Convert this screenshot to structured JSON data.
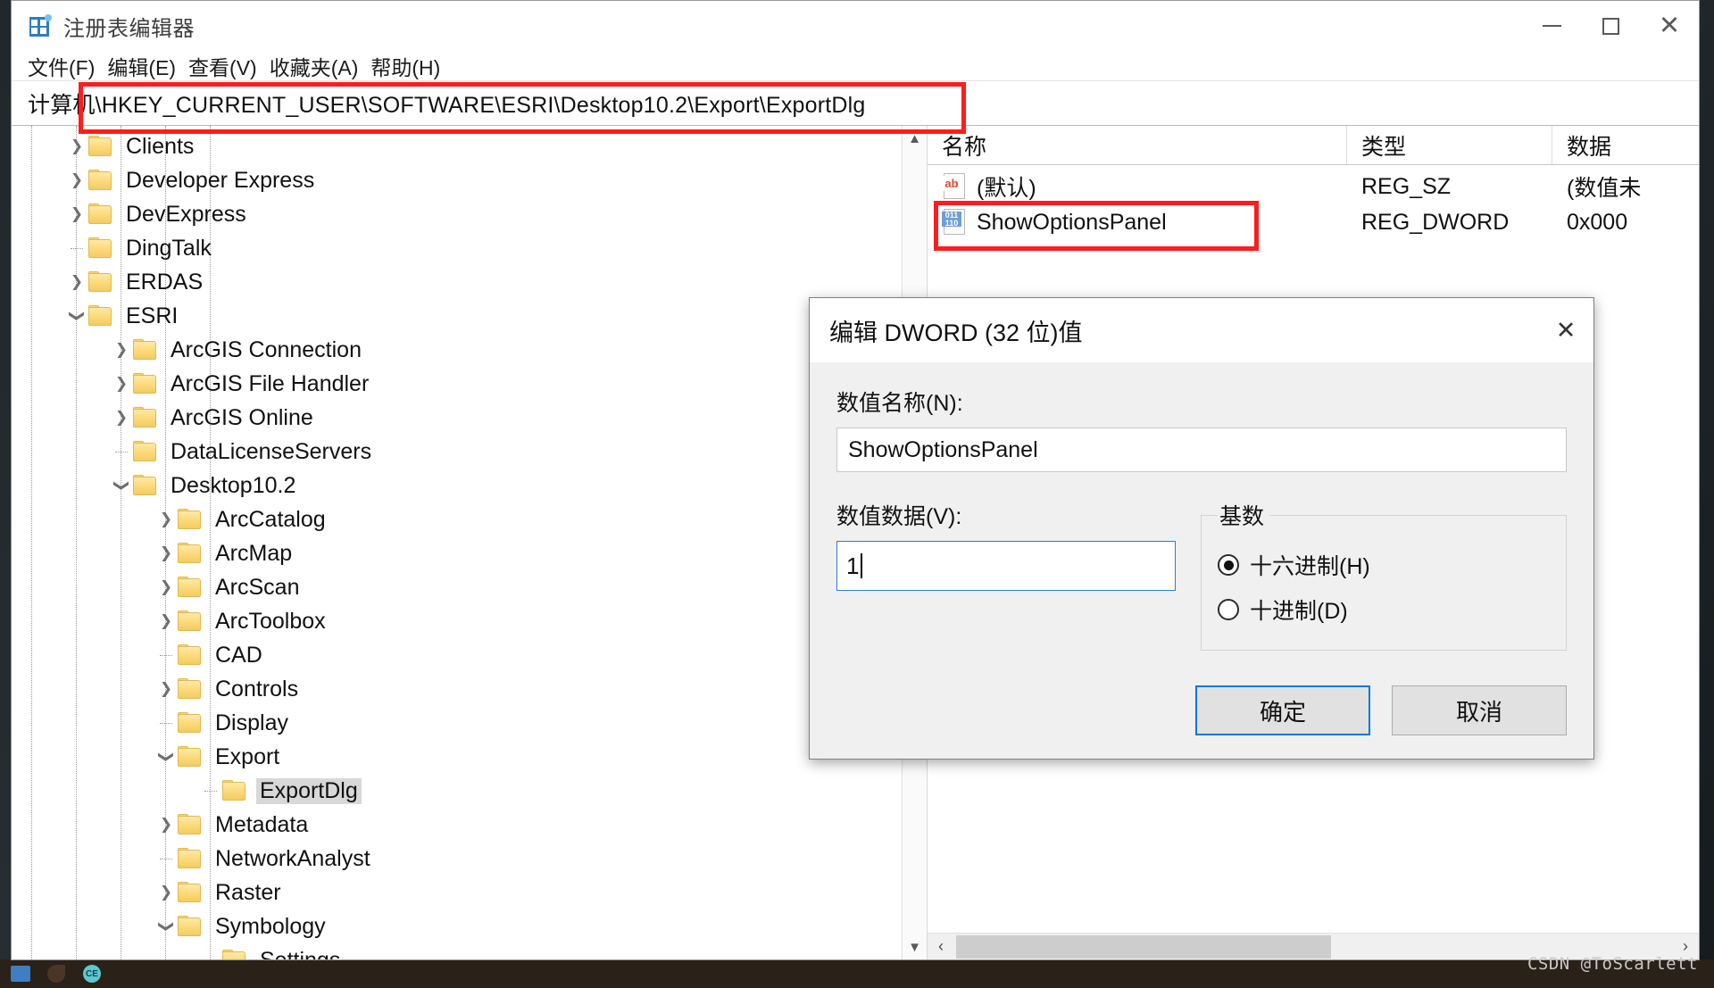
{
  "window": {
    "title": "注册表编辑器",
    "app_icon": "registry-editor-icon",
    "minimize_label": "最小化",
    "maximize_label": "最大化",
    "close_label": "关闭"
  },
  "menu": {
    "items": [
      {
        "label": "文件(F)"
      },
      {
        "label": "编辑(E)"
      },
      {
        "label": "查看(V)"
      },
      {
        "label": "收藏夹(A)"
      },
      {
        "label": "帮助(H)"
      }
    ]
  },
  "address": {
    "prefix": "计算机",
    "path": "\\HKEY_CURRENT_USER\\SOFTWARE\\ESRI\\Desktop10.2\\Export\\ExportDlg",
    "full": "计算机\\HKEY_CURRENT_USER\\SOFTWARE\\ESRI\\Desktop10.2\\Export\\ExportDlg"
  },
  "tree": {
    "items": [
      {
        "label": "Clients",
        "indent": 1,
        "twist": "collapsed",
        "selected": false
      },
      {
        "label": "Developer Express",
        "indent": 1,
        "twist": "collapsed",
        "selected": false
      },
      {
        "label": "DevExpress",
        "indent": 1,
        "twist": "collapsed",
        "selected": false
      },
      {
        "label": "DingTalk",
        "indent": 1,
        "twist": "none",
        "selected": false
      },
      {
        "label": "ERDAS",
        "indent": 1,
        "twist": "collapsed",
        "selected": false
      },
      {
        "label": "ESRI",
        "indent": 1,
        "twist": "expanded",
        "selected": false
      },
      {
        "label": "ArcGIS Connection",
        "indent": 2,
        "twist": "collapsed",
        "selected": false
      },
      {
        "label": "ArcGIS File Handler",
        "indent": 2,
        "twist": "collapsed",
        "selected": false
      },
      {
        "label": "ArcGIS Online",
        "indent": 2,
        "twist": "collapsed",
        "selected": false
      },
      {
        "label": "DataLicenseServers",
        "indent": 2,
        "twist": "none",
        "selected": false
      },
      {
        "label": "Desktop10.2",
        "indent": 2,
        "twist": "expanded",
        "selected": false
      },
      {
        "label": "ArcCatalog",
        "indent": 3,
        "twist": "collapsed",
        "selected": false
      },
      {
        "label": "ArcMap",
        "indent": 3,
        "twist": "collapsed",
        "selected": false
      },
      {
        "label": "ArcScan",
        "indent": 3,
        "twist": "collapsed",
        "selected": false
      },
      {
        "label": "ArcToolbox",
        "indent": 3,
        "twist": "collapsed",
        "selected": false
      },
      {
        "label": "CAD",
        "indent": 3,
        "twist": "none",
        "selected": false
      },
      {
        "label": "Controls",
        "indent": 3,
        "twist": "collapsed",
        "selected": false
      },
      {
        "label": "Display",
        "indent": 3,
        "twist": "none",
        "selected": false
      },
      {
        "label": "Export",
        "indent": 3,
        "twist": "expanded",
        "selected": false
      },
      {
        "label": "ExportDlg",
        "indent": 4,
        "twist": "none",
        "selected": true
      },
      {
        "label": "Metadata",
        "indent": 3,
        "twist": "collapsed",
        "selected": false
      },
      {
        "label": "NetworkAnalyst",
        "indent": 3,
        "twist": "none",
        "selected": false
      },
      {
        "label": "Raster",
        "indent": 3,
        "twist": "collapsed",
        "selected": false
      },
      {
        "label": "Symbology",
        "indent": 3,
        "twist": "expanded",
        "selected": false
      },
      {
        "label": "Settings",
        "indent": 4,
        "twist": "none",
        "selected": false
      }
    ],
    "scroll_up": "▲",
    "scroll_down": "▼"
  },
  "values": {
    "columns": {
      "name": "名称",
      "type": "类型",
      "data": "数据"
    },
    "rows": [
      {
        "name": "(默认)",
        "icon": "string-value-icon",
        "type": "REG_SZ",
        "data": "(数值未"
      },
      {
        "name": "ShowOptionsPanel",
        "icon": "dword-value-icon",
        "type": "REG_DWORD",
        "data": "0x000"
      }
    ],
    "hscroll_left": "‹",
    "hscroll_right": "›"
  },
  "dialog": {
    "title": "编辑 DWORD (32 位)值",
    "close_glyph": "✕",
    "name_label": "数值名称(N):",
    "name_value": "ShowOptionsPanel",
    "data_label": "数值数据(V):",
    "data_value": "1",
    "base_legend": "基数",
    "base_options": [
      {
        "label": "十六进制(H)",
        "selected": true
      },
      {
        "label": "十进制(D)",
        "selected": false
      }
    ],
    "ok_label": "确定",
    "cancel_label": "取消"
  },
  "annotations": {
    "address_highlight": "address-bar-red-box",
    "value_row_highlight": "show-options-panel-red-box",
    "data_input_highlight": "value-data-red-box",
    "color": "#ff1d1d"
  },
  "watermark": "CSDN @ToScarlett",
  "taskbar": {
    "icons": [
      "explorer-icon",
      "leaf-icon",
      "ce-icon"
    ],
    "ce_label": "CE"
  }
}
